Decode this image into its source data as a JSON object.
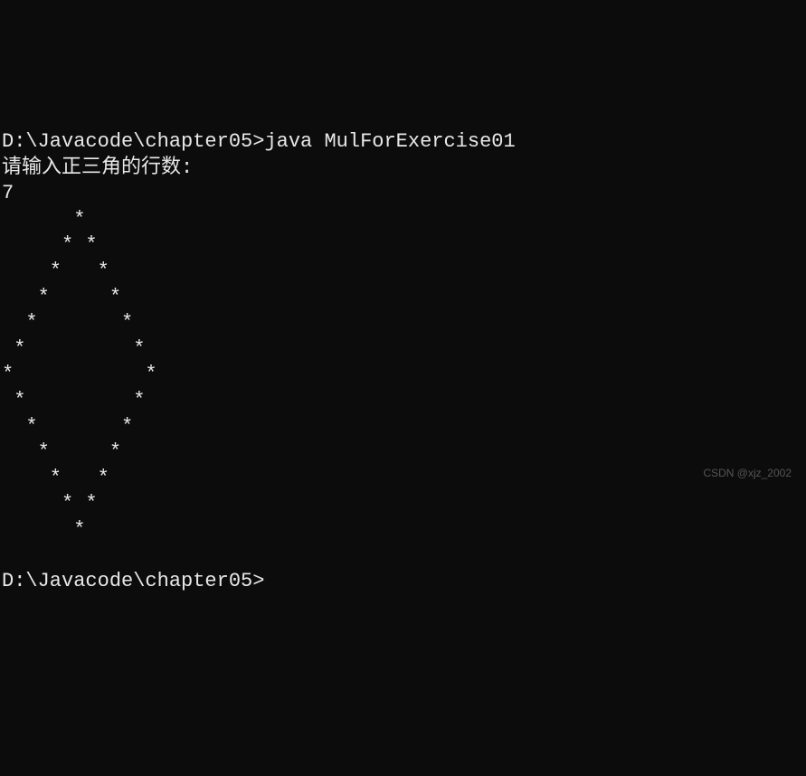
{
  "terminal": {
    "command_line": "D:\\Javacode\\chapter05>java MulForExercise01",
    "prompt_message": "请输入正三角的行数:",
    "user_input": "7",
    "diamond_output": [
      "      *",
      "     * *",
      "    *   *",
      "   *     *",
      "  *       *",
      " *         *",
      "*           *",
      " *         *",
      "  *       *",
      "   *     *",
      "    *   *",
      "     * *",
      "      *"
    ],
    "final_prompt": "D:\\Javacode\\chapter05>"
  },
  "watermark": "CSDN @xjz_2002"
}
